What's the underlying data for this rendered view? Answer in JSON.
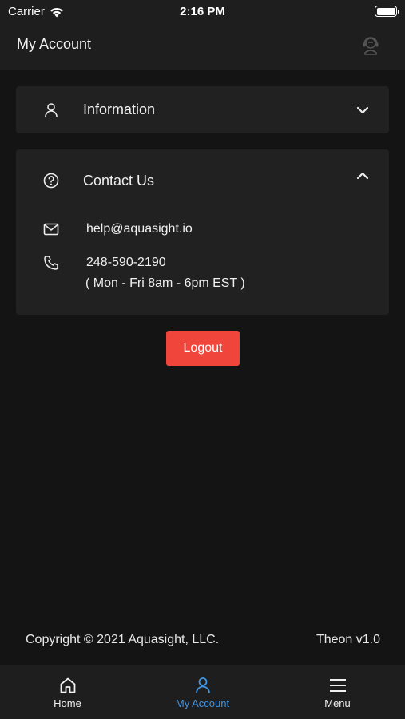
{
  "status_bar": {
    "carrier": "Carrier",
    "time": "2:16 PM"
  },
  "header": {
    "title": "My Account",
    "support_icon": "headset-support-icon"
  },
  "sections": {
    "information": {
      "title": "Information",
      "icon": "person-icon",
      "expanded": false
    },
    "contact": {
      "title": "Contact Us",
      "icon": "question-circle-icon",
      "expanded": true,
      "email": "help@aquasight.io",
      "phone": "248-590-2190",
      "hours": "( Mon - Fri 8am - 6pm EST )"
    }
  },
  "logout_label": "Logout",
  "footer": {
    "copyright": "Copyright © 2021 Aquasight, LLC.",
    "version": "Theon v1.0"
  },
  "tabs": [
    {
      "label": "Home",
      "icon": "home-icon",
      "active": false
    },
    {
      "label": "My Account",
      "icon": "person-icon",
      "active": true
    },
    {
      "label": "Menu",
      "icon": "hamburger-menu-icon",
      "active": false
    }
  ],
  "colors": {
    "background": "#141414",
    "surface": "#212121",
    "accent": "#3f96e6",
    "logout": "#f0453a"
  }
}
